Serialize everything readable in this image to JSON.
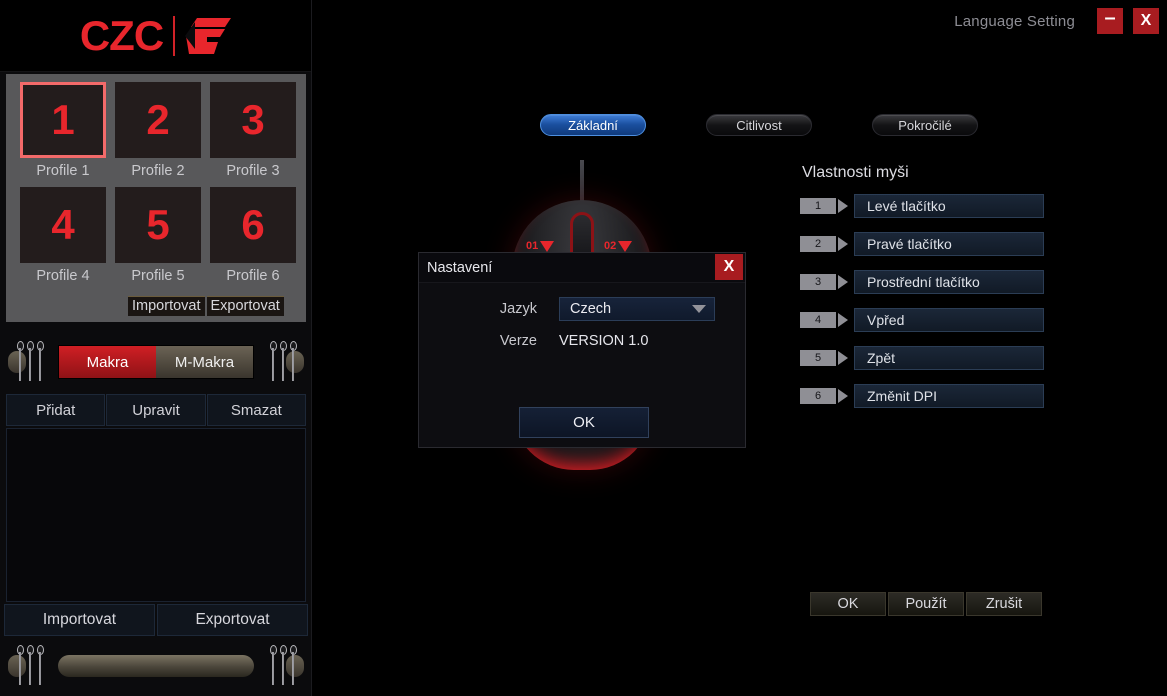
{
  "window": {
    "language_setting_label": "Language Setting",
    "minimize_label": "–",
    "close_label": "X"
  },
  "sidebar": {
    "logo_text": "CZC",
    "logo_mark": "gaming-g-icon",
    "profiles": [
      {
        "number": "1",
        "label": "Profile 1",
        "selected": true
      },
      {
        "number": "2",
        "label": "Profile 2",
        "selected": false
      },
      {
        "number": "3",
        "label": "Profile 3",
        "selected": false
      },
      {
        "number": "4",
        "label": "Profile 4",
        "selected": false
      },
      {
        "number": "5",
        "label": "Profile 5",
        "selected": false
      },
      {
        "number": "6",
        "label": "Profile 6",
        "selected": false
      }
    ],
    "profile_import_label": "Importovat",
    "profile_export_label": "Exportovat",
    "macro_tabs": [
      {
        "label": "Makra",
        "active": true
      },
      {
        "label": "M-Makra",
        "active": false
      }
    ],
    "macro_actions": [
      {
        "label": "Přidat"
      },
      {
        "label": "Upravit"
      },
      {
        "label": "Smazat"
      }
    ],
    "macro_list_items": [],
    "import_label": "Importovat",
    "export_label": "Exportovat"
  },
  "main": {
    "tabs": [
      {
        "label": "Základní",
        "active": true
      },
      {
        "label": "Citlivost",
        "active": false
      },
      {
        "label": "Pokročilé",
        "active": false
      }
    ],
    "mouse_tags": [
      {
        "label": "01"
      },
      {
        "label": "02"
      }
    ],
    "props_title": "Vlastnosti myši",
    "props": [
      {
        "index": "1",
        "label": "Levé tlačítko"
      },
      {
        "index": "2",
        "label": "Pravé tlačítko"
      },
      {
        "index": "3",
        "label": "Prostřední tlačítko"
      },
      {
        "index": "4",
        "label": "Vpřed"
      },
      {
        "index": "5",
        "label": "Zpět"
      },
      {
        "index": "6",
        "label": "Změnit DPI"
      }
    ],
    "actions": [
      {
        "label": "OK"
      },
      {
        "label": "Použít"
      },
      {
        "label": "Zrušit"
      }
    ]
  },
  "dialog": {
    "title": "Nastavení",
    "close_label": "X",
    "language_label": "Jazyk",
    "language_value": "Czech",
    "language_options": [
      "Czech"
    ],
    "version_label": "Verze",
    "version_value": "VERSION 1.0",
    "ok_label": "OK"
  },
  "colors": {
    "brand_red": "#e8262c",
    "close_red": "#a81c20",
    "accent_blue": "#1a4f9e",
    "sidebar_gray": "#58585a",
    "background": "#000000"
  }
}
